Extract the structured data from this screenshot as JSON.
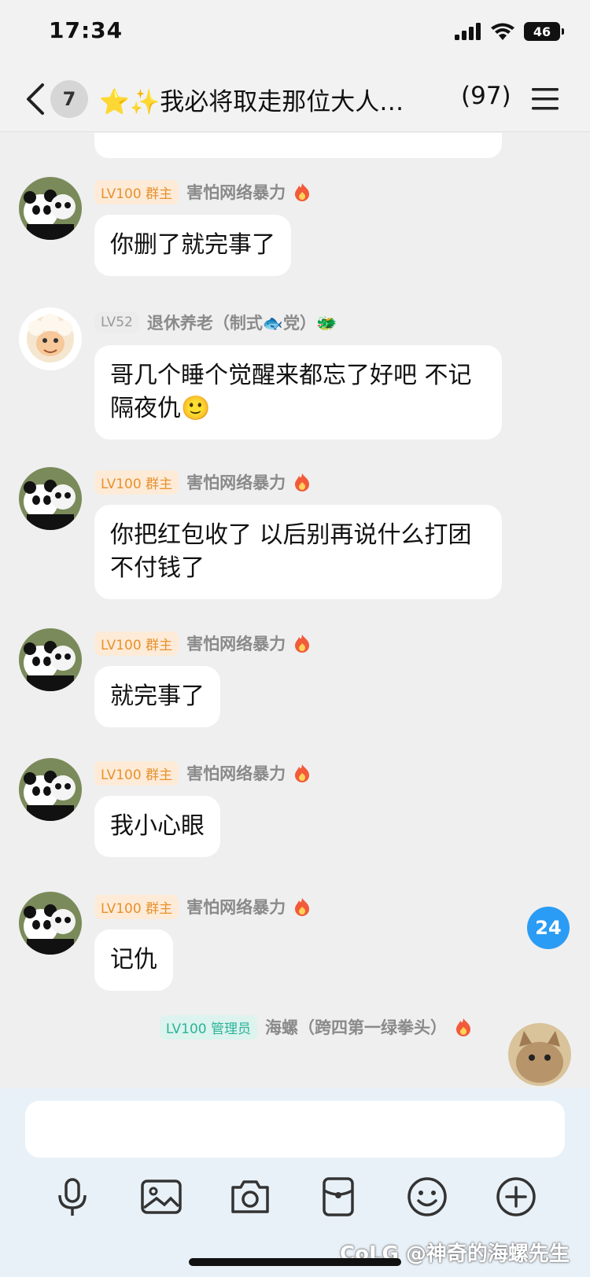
{
  "status_bar": {
    "time": "17:34",
    "battery": "46"
  },
  "header": {
    "unread_badge": "7",
    "title": "⭐✨我必将取走那位大人…",
    "member_count": "(97)"
  },
  "messages": [
    {
      "level": "LV100",
      "role": "群主",
      "sender": "害怕网络暴力",
      "text": "你删了就完事了"
    },
    {
      "level": "LV52",
      "role": "",
      "sender": "退休养老（制式🐟党）🐲",
      "text": "哥几个睡个觉醒来都忘了好吧 不记隔夜仇🙂"
    },
    {
      "level": "LV100",
      "role": "群主",
      "sender": "害怕网络暴力",
      "text": "你把红包收了 以后别再说什么打团不付钱了"
    },
    {
      "level": "LV100",
      "role": "群主",
      "sender": "害怕网络暴力",
      "text": "就完事了"
    },
    {
      "level": "LV100",
      "role": "群主",
      "sender": "害怕网络暴力",
      "text": "我小心眼"
    },
    {
      "level": "LV100",
      "role": "群主",
      "sender": "害怕网络暴力",
      "text": "记仇"
    },
    {
      "level": "LV100",
      "role": "管理员",
      "sender": "海螺（跨四第一绿拳头）",
      "text": ""
    }
  ],
  "unread_float_count": "24",
  "input": {
    "placeholder": ""
  },
  "toolbar_icons": [
    "microphone-icon",
    "image-icon",
    "camera-icon",
    "red-packet-icon",
    "emoji-icon",
    "plus-icon"
  ],
  "watermark": "CoLG @神奇的海螺先生",
  "colors": {
    "owner_badge": "#e8912e",
    "admin_badge": "#2cb39a",
    "unread_blue": "#2a9cf5"
  }
}
